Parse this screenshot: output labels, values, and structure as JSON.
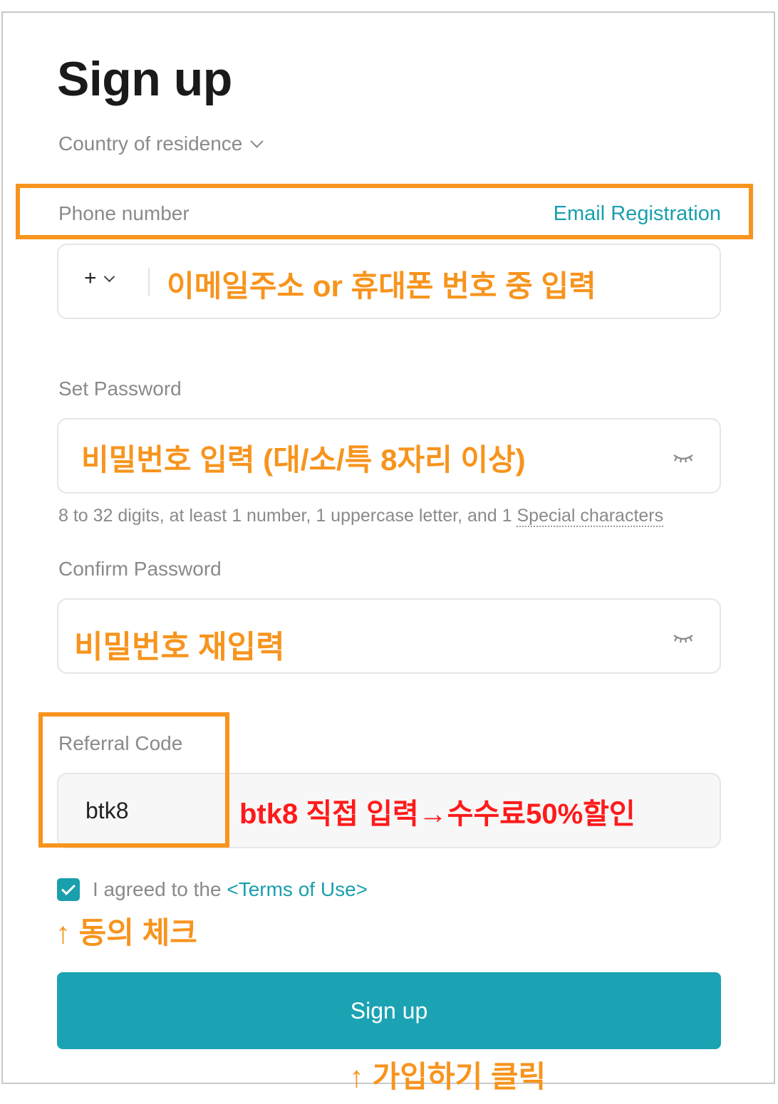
{
  "page": {
    "title": "Sign up"
  },
  "country": {
    "label": "Country of residence"
  },
  "phone": {
    "label": "Phone number",
    "email_link": "Email Registration",
    "prefix": "+",
    "annotation": "이메일주소 or 휴대폰 번호 중 입력"
  },
  "password": {
    "label": "Set Password",
    "annotation": "비밀번호 입력 (대/소/특 8자리 이상)",
    "hint_text": "8 to 32 digits, at least 1 number, 1 uppercase letter, and 1 ",
    "hint_link": "Special characters"
  },
  "confirm": {
    "label": "Confirm Password",
    "annotation": "비밀번호 재입력"
  },
  "referral": {
    "label": "Referral Code",
    "value": "btk8",
    "annotation": "btk8 직접 입력→수수료50%할인"
  },
  "agreement": {
    "checked": true,
    "text": "I agreed to the ",
    "terms_link": "<Terms of Use>",
    "annotation": "↑ 동의 체크"
  },
  "submit": {
    "label": "Sign up",
    "annotation": "↑ 가입하기 클릭"
  },
  "colors": {
    "accent": "#1ba3b3",
    "highlight": "#f7941d",
    "annotation_red": "#ff1a1a"
  }
}
